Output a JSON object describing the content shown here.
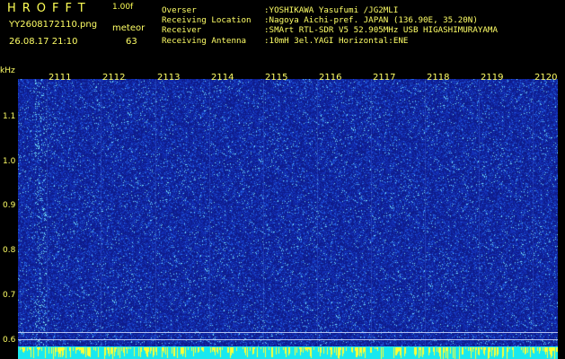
{
  "header": {
    "app_name": "HROFFT",
    "version": "1.00f",
    "filename": "YY2608172110.png",
    "mode": "meteor",
    "datetime": "26.08.17 21:10",
    "count": "63"
  },
  "info": [
    {
      "label": "Overser",
      "value": ":YOSHIKAWA Yasufumi /JG2MLI"
    },
    {
      "label": "Receiving Location",
      "value": ":Nagoya Aichi-pref. JAPAN (136.90E, 35.20N)"
    },
    {
      "label": "Receiver",
      "value": ":SMArt RTL-SDR V5 52.905MHz USB HIGASHIMURAYAMA"
    },
    {
      "label": "Receiving Antenna",
      "value": ":10mH 3el.YAGI Horizontal:ENE"
    }
  ],
  "axis": {
    "y_unit": "kHz",
    "y_ticks": [
      "1.1",
      "1.0",
      "0.9",
      "0.8",
      "0.7",
      "0.6"
    ],
    "x_ticks": [
      "2111",
      "2112",
      "2113",
      "2114",
      "2115",
      "2116",
      "2117",
      "2118",
      "2119",
      "2120"
    ]
  },
  "colors": {
    "text": "#ffff66",
    "background": "#000000",
    "plot_base": "#1a2fa8",
    "speckle_bright": "#66ddff",
    "bottom_bar": "#18e8f0",
    "bottom_marks": "#ffff33"
  }
}
